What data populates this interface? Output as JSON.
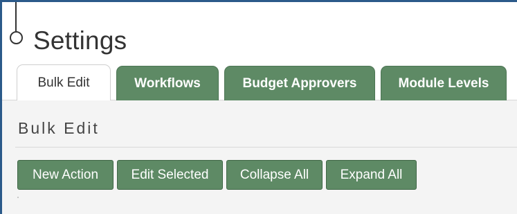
{
  "page": {
    "title": "Settings"
  },
  "tabs": [
    {
      "label": "Bulk Edit",
      "active": true
    },
    {
      "label": "Workflows",
      "active": false
    },
    {
      "label": "Budget Approvers",
      "active": false
    },
    {
      "label": "Module Levels",
      "active": false
    }
  ],
  "section": {
    "title": "Bulk Edit"
  },
  "actions": {
    "new_action": "New Action",
    "edit_selected": "Edit Selected",
    "collapse_all": "Collapse All",
    "expand_all": "Expand All"
  },
  "colors": {
    "accent_green": "#5e8a65",
    "frame_border": "#2b5a8a",
    "panel_background": "#f4f4f4"
  }
}
